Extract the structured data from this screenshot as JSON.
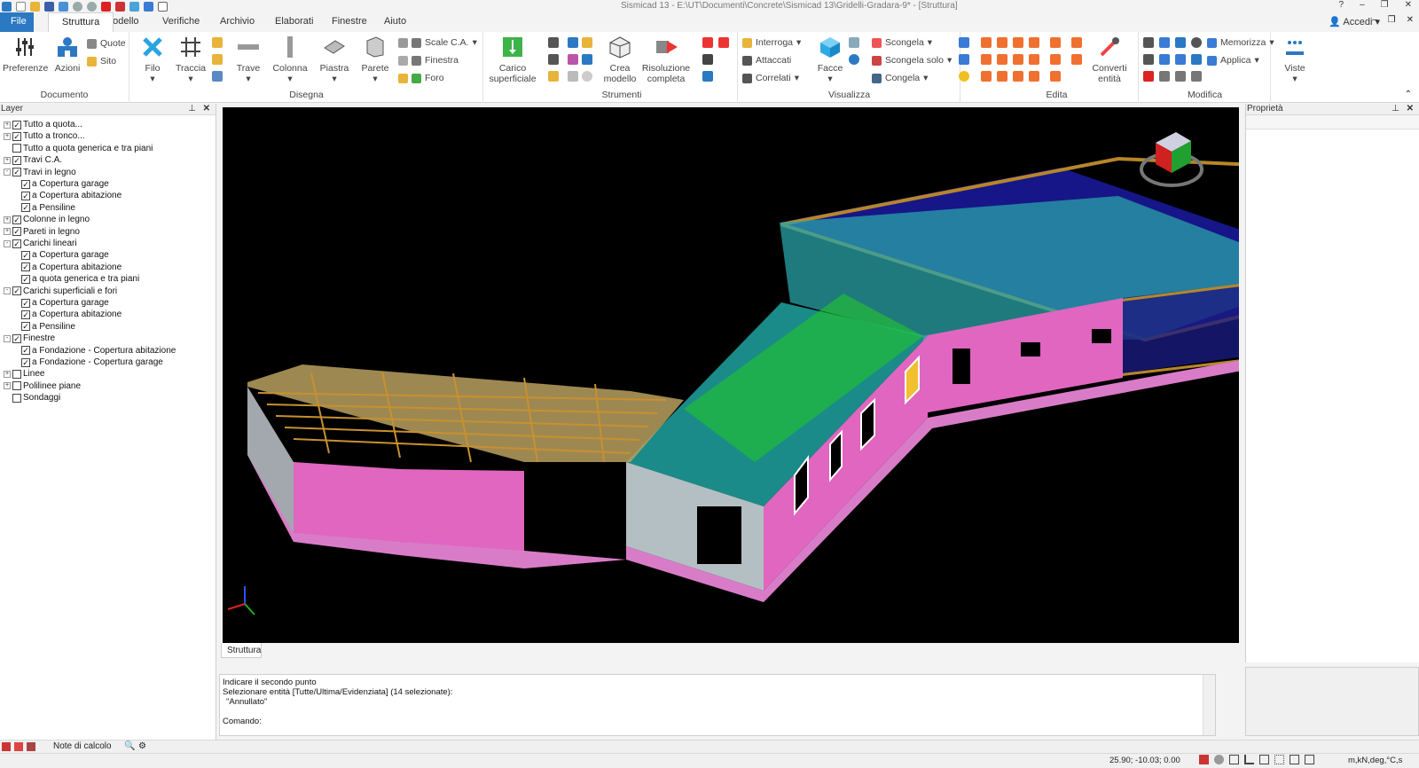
{
  "window": {
    "title": "Sismicad 13 - E:\\UT\\Documenti\\Concrete\\Sismicad 13\\Gridelli-Gradara-9* - [Struttura]"
  },
  "menu": {
    "file": "File",
    "tabs": [
      "Struttura",
      "Modello",
      "Verifiche",
      "Archivio",
      "Elaborati",
      "Finestre",
      "Aiuto"
    ],
    "account": "Accedi"
  },
  "ribbon": {
    "documento": {
      "label": "Documento",
      "preferenze": "Preferenze",
      "azioni": "Azioni",
      "quote": "Quote",
      "sito": "Sito"
    },
    "disegna": {
      "label": "Disegna",
      "filo": "Filo",
      "traccia": "Traccia",
      "trave": "Trave",
      "colonna": "Colonna",
      "piastra": "Piastra",
      "parete": "Parete",
      "scale": "Scale C.A.",
      "finestra": "Finestra",
      "foro": "Foro",
      "carico": "Carico superficiale"
    },
    "strumenti": {
      "label": "Strumenti",
      "crea": "Crea modello",
      "risoluzione": "Risoluzione completa"
    },
    "visualizza": {
      "label": "Visualizza",
      "interroga": "Interroga",
      "attaccati": "Attaccati",
      "correlati": "Correlati",
      "facce": "Facce",
      "scongela": "Scongela",
      "scongela_solo": "Scongela solo",
      "congela": "Congela"
    },
    "edita": {
      "label": "Edita",
      "converti": "Converti entità"
    },
    "modifica": {
      "label": "Modifica",
      "memorizza": "Memorizza",
      "applica": "Applica",
      "viste": "Viste"
    }
  },
  "layer_panel": {
    "title": "Layer",
    "items": [
      {
        "label": "Tutto a quota...",
        "level": 0,
        "expander": "+",
        "checked": true
      },
      {
        "label": "Tutto a tronco...",
        "level": 0,
        "expander": "+",
        "checked": true
      },
      {
        "label": "Tutto a quota generica e tra piani",
        "level": 0,
        "expander": "",
        "checked": false
      },
      {
        "label": "Travi C.A.",
        "level": 0,
        "expander": "+",
        "checked": true
      },
      {
        "label": "Travi in legno",
        "level": 0,
        "expander": "-",
        "checked": true
      },
      {
        "label": "a Copertura garage",
        "level": 1,
        "expander": "",
        "checked": true
      },
      {
        "label": "a Copertura abitazione",
        "level": 1,
        "expander": "",
        "checked": true
      },
      {
        "label": "a Pensiline",
        "level": 1,
        "expander": "",
        "checked": true
      },
      {
        "label": "Colonne in legno",
        "level": 0,
        "expander": "+",
        "checked": true
      },
      {
        "label": "Pareti in legno",
        "level": 0,
        "expander": "+",
        "checked": true
      },
      {
        "label": "Carichi lineari",
        "level": 0,
        "expander": "-",
        "checked": true
      },
      {
        "label": "a Copertura garage",
        "level": 1,
        "expander": "",
        "checked": true
      },
      {
        "label": "a Copertura abitazione",
        "level": 1,
        "expander": "",
        "checked": true
      },
      {
        "label": "a quota generica e tra piani",
        "level": 1,
        "expander": "",
        "checked": true
      },
      {
        "label": "Carichi superficiali e fori",
        "level": 0,
        "expander": "-",
        "checked": true
      },
      {
        "label": "a Copertura garage",
        "level": 1,
        "expander": "",
        "checked": true
      },
      {
        "label": "a Copertura abitazione",
        "level": 1,
        "expander": "",
        "checked": true
      },
      {
        "label": "a Pensiline",
        "level": 1,
        "expander": "",
        "checked": true
      },
      {
        "label": "Finestre",
        "level": 0,
        "expander": "-",
        "checked": true
      },
      {
        "label": "a Fondazione - Copertura abitazione",
        "level": 1,
        "expander": "",
        "checked": true
      },
      {
        "label": "a Fondazione - Copertura garage",
        "level": 1,
        "expander": "",
        "checked": true
      },
      {
        "label": "Linee",
        "level": 0,
        "expander": "+",
        "checked": false
      },
      {
        "label": "Polilinee piane",
        "level": 0,
        "expander": "+",
        "checked": false
      },
      {
        "label": "Sondaggi",
        "level": 0,
        "expander": "",
        "checked": false
      }
    ]
  },
  "properties_panel": {
    "title": "Proprietà"
  },
  "viewport": {
    "tab": "Struttura"
  },
  "command": {
    "lines": [
      "Indicare il secondo punto",
      "Selezionare entità [Tutte/Ultima/Evidenziata] (14 selezionate):",
      "\"Annullato\"",
      "",
      "Comando:"
    ]
  },
  "bottom": {
    "notes": "Note di calcolo"
  },
  "status": {
    "coords": "25.90; -10.03; 0.00",
    "units": "m,kN,deg,°C,s"
  }
}
